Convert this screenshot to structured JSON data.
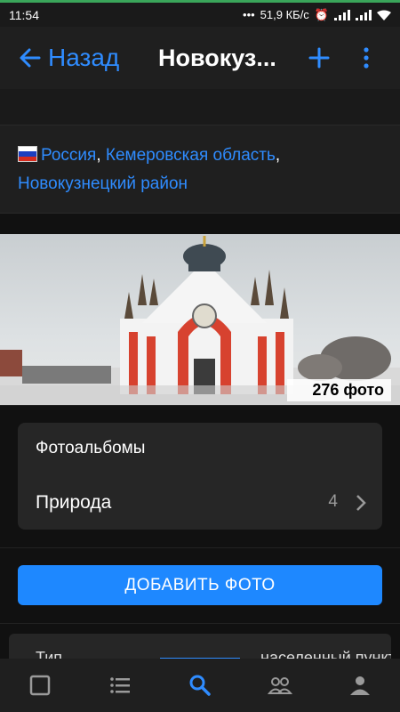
{
  "status_bar": {
    "time": "11:54",
    "speed": "51,9 КБ/с",
    "icons": [
      "dots-icon",
      "alarm-icon",
      "signal-icon",
      "signal-icon",
      "wifi-icon"
    ]
  },
  "nav": {
    "back_label": "Назад",
    "title": "Новокуз...",
    "add_icon": "plus-icon",
    "menu_icon": "more-vertical-icon"
  },
  "location": {
    "country": "Россия",
    "region": "Кемеровская область",
    "district": "Новокузнецкий район",
    "separator": ","
  },
  "photo": {
    "count_label": "276 фото",
    "description": ""
  },
  "albums": {
    "title": "Фотоальбомы",
    "items": [
      {
        "name": "Природа",
        "count": "4"
      }
    ]
  },
  "actions": {
    "add_photo": "ДОБАВИТЬ ФОТО"
  },
  "info": {
    "label": "Тип",
    "value": "населенный пункт"
  },
  "tabbar": {
    "tabs": [
      "square-icon",
      "list-icon",
      "search-icon",
      "friends-icon",
      "profile-icon"
    ],
    "active": 2,
    "colors": {
      "active": "#2f8cff",
      "inactive": "#9a9a9a"
    }
  },
  "colors": {
    "accent": "#2f8cff",
    "button": "#1e88ff",
    "background": "#111111",
    "card": "#262626"
  }
}
